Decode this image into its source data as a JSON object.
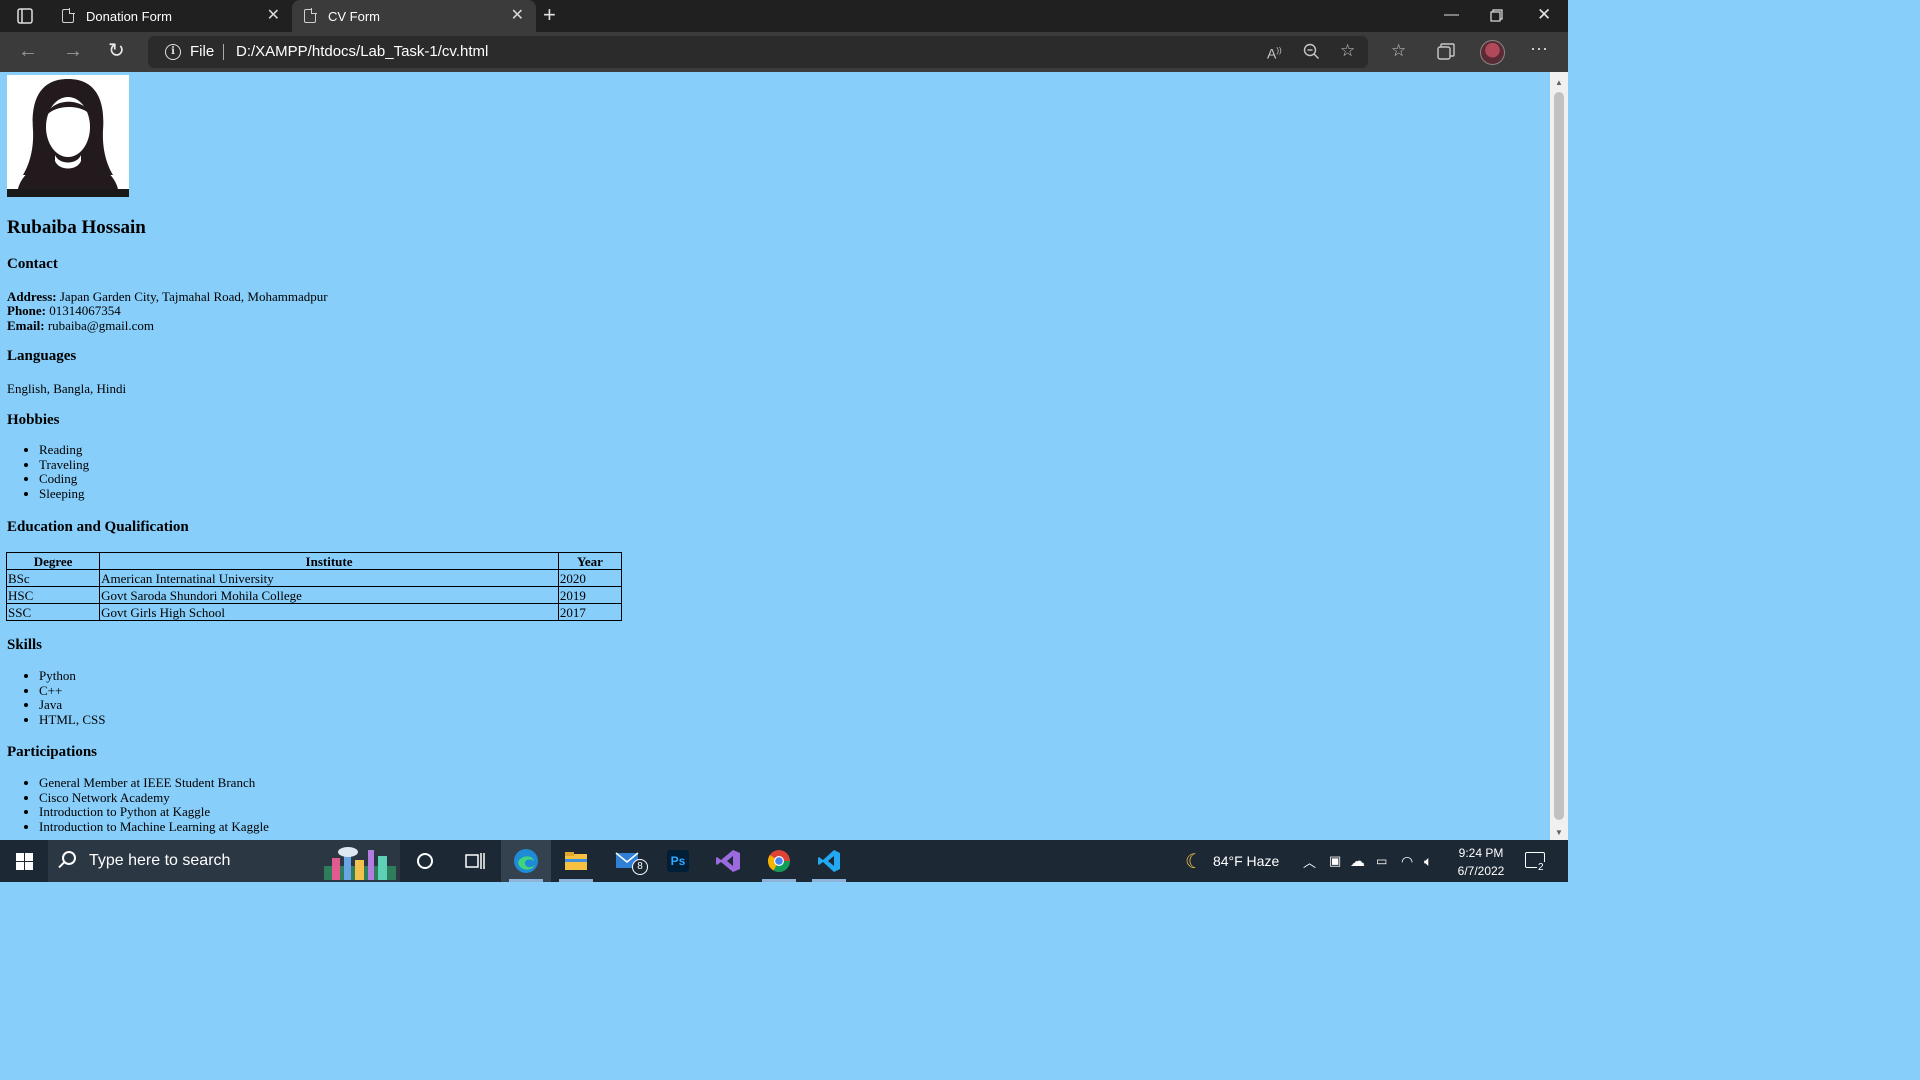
{
  "browser": {
    "tabs": [
      {
        "title": "Donation Form",
        "active": false
      },
      {
        "title": "CV Form",
        "active": true
      }
    ],
    "address": {
      "scheme_label": "File",
      "url": "D:/XAMPP/htdocs/Lab_Task-1/cv.html"
    }
  },
  "cv": {
    "name": "Rubaiba Hossain",
    "contact": {
      "heading": "Contact",
      "address_label": "Address:",
      "address": "Japan Garden City, Tajmahal Road, Mohammadpur",
      "phone_label": "Phone:",
      "phone": "01314067354",
      "email_label": "Email:",
      "email": "rubaiba@gmail.com"
    },
    "languages": {
      "heading": "Languages",
      "text": "English, Bangla, Hindi"
    },
    "hobbies": {
      "heading": "Hobbies",
      "items": [
        "Reading",
        "Traveling",
        "Coding",
        "Sleeping"
      ]
    },
    "education": {
      "heading": "Education and Qualification",
      "columns": [
        "Degree",
        "Institute",
        "Year"
      ],
      "rows": [
        [
          "BSc",
          "American Internatinal University",
          "2020"
        ],
        [
          "HSC",
          "Govt Saroda Shundori Mohila College",
          "2019"
        ],
        [
          "SSC",
          "Govt Girls High School",
          "2017"
        ]
      ]
    },
    "skills": {
      "heading": "Skills",
      "items": [
        "Python",
        "C++",
        "Java",
        "HTML, CSS"
      ]
    },
    "participations": {
      "heading": "Participations",
      "items": [
        "General Member at IEEE Student Branch",
        "Cisco Network Academy",
        "Introduction to Python at Kaggle",
        "Introduction to Machine Learning at Kaggle"
      ]
    }
  },
  "taskbar": {
    "search_placeholder": "Type here to search",
    "mail_badge": "8",
    "weather": "84°F Haze",
    "time": "9:24 PM",
    "date": "6/7/2022",
    "notification_count": "2"
  },
  "colors": {
    "page_background": "#87cefa",
    "tab_bar": "#202020",
    "toolbar": "#3b3b3b",
    "taskbar": "#1c2834"
  }
}
